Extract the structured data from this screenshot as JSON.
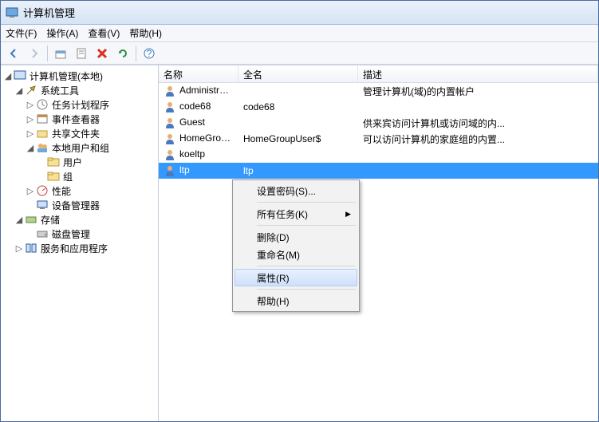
{
  "title": "计算机管理",
  "menu": {
    "file": "文件(F)",
    "action": "操作(A)",
    "view": "查看(V)",
    "help": "帮助(H)"
  },
  "tree": {
    "root": "计算机管理(本地)",
    "systools": "系统工具",
    "taskscheduler": "任务计划程序",
    "eventviewer": "事件查看器",
    "sharedfolders": "共享文件夹",
    "localusers": "本地用户和组",
    "users": "用户",
    "groups": "组",
    "performance": "性能",
    "devmgr": "设备管理器",
    "storage": "存储",
    "diskmgmt": "磁盘管理",
    "services": "服务和应用程序"
  },
  "columns": {
    "name": "名称",
    "fullname": "全名",
    "desc": "描述"
  },
  "rows": [
    {
      "name": "Administrat...",
      "full": "",
      "desc": "管理计算机(域)的内置帐户"
    },
    {
      "name": "code68",
      "full": "code68",
      "desc": ""
    },
    {
      "name": "Guest",
      "full": "",
      "desc": "供来宾访问计算机或访问域的内..."
    },
    {
      "name": "HomeGrou...",
      "full": "HomeGroupUser$",
      "desc": "可以访问计算机的家庭组的内置..."
    },
    {
      "name": "koeltp",
      "full": "",
      "desc": ""
    },
    {
      "name": "ltp",
      "full": "ltp",
      "desc": ""
    }
  ],
  "ctx": {
    "setpwd": "设置密码(S)...",
    "alltasks": "所有任务(K)",
    "delete": "删除(D)",
    "rename": "重命名(M)",
    "properties": "属性(R)",
    "help": "帮助(H)"
  }
}
